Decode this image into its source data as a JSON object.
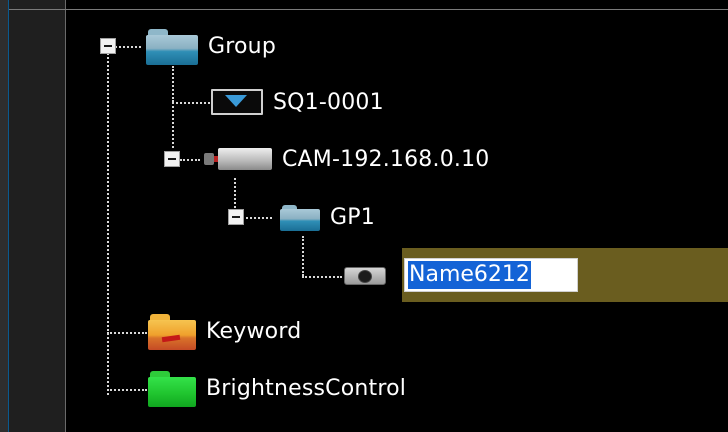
{
  "tree": {
    "nodes": [
      {
        "id": "group",
        "label": "Group",
        "icon": "folder-blue-icon",
        "expanded": true
      },
      {
        "id": "sq1",
        "label": "SQ1-0001",
        "icon": "monitor-icon"
      },
      {
        "id": "cam",
        "label": "CAM-192.168.0.10",
        "icon": "camera-icon",
        "expanded": true
      },
      {
        "id": "gp1",
        "label": "GP1",
        "icon": "folder-blue-icon",
        "expanded": true
      },
      {
        "id": "name",
        "label": "Name6212",
        "icon": "device-icon",
        "editing": true
      },
      {
        "id": "keyword",
        "label": "Keyword",
        "icon": "folder-orange-icon"
      },
      {
        "id": "brightness",
        "label": "BrightnessControl",
        "icon": "folder-green-icon"
      }
    ],
    "edit_value": "Name6212"
  },
  "colors": {
    "background": "#000000",
    "selection_row": "#6a5d1f",
    "selection_text_bg": "#1463d6",
    "text": "#ffffff"
  }
}
